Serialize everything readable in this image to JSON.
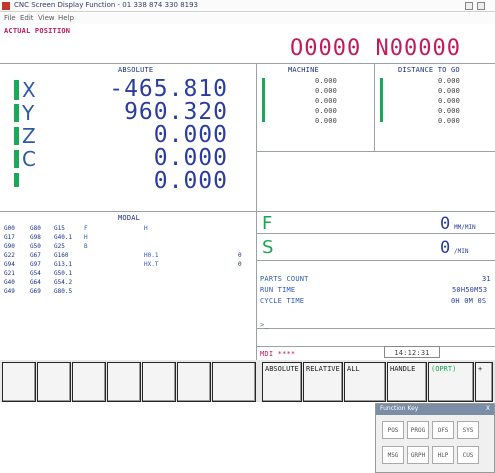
{
  "window": {
    "title": "CNC Screen Display Function - 01 338 874 330 8193",
    "menu": [
      "File",
      "Edit",
      "View",
      "Help"
    ]
  },
  "header": {
    "left": "ACTUAL POSITION",
    "program": "O0000 N00000"
  },
  "absolute": {
    "title": "ABSOLUTE",
    "axes": [
      {
        "name": "X",
        "value": "-465.810"
      },
      {
        "name": "Y",
        "value": "960.320"
      },
      {
        "name": "Z",
        "value": "0.000"
      },
      {
        "name": "C",
        "value": "0.000"
      },
      {
        "name": "",
        "value": "0.000"
      }
    ]
  },
  "machine": {
    "title": "MACHINE",
    "values": [
      "0.000",
      "0.000",
      "0.000",
      "0.000",
      "0.000"
    ]
  },
  "distance": {
    "title": "DISTANCE TO GO",
    "values": [
      "0.000",
      "0.000",
      "0.000",
      "0.000",
      "0.000"
    ]
  },
  "modal": {
    "title": "MODAL",
    "rows": [
      [
        "G00",
        "G80",
        "G15",
        "F",
        "H"
      ],
      [
        "G17",
        "G98",
        "G40.1",
        "H",
        ""
      ],
      [
        "G90",
        "G50",
        "G25",
        "B",
        ""
      ],
      [
        "G22",
        "G67",
        "G160",
        "H0.1",
        "0"
      ],
      [
        "G94",
        "G97",
        "G13.1",
        "HX.T",
        "0"
      ],
      [
        "G21",
        "G54",
        "G50.1",
        "",
        ""
      ],
      [
        "G40",
        "G64",
        "G54.2",
        "",
        ""
      ],
      [
        "G49",
        "G69",
        "G80.5",
        "",
        ""
      ]
    ]
  },
  "feed": {
    "label": "F",
    "value": "0",
    "unit": "MM/MIN"
  },
  "spindle": {
    "label": "S",
    "value": "0",
    "unit": "/MIN"
  },
  "counters": [
    {
      "label": "PARTS COUNT",
      "value": "31"
    },
    {
      "label": "RUN TIME",
      "value": "50H50M53"
    },
    {
      "label": "CYCLE TIME",
      "value": "0H 0M 0S"
    }
  ],
  "input_prompt": ">_",
  "status": {
    "mode": "MDI ****",
    "time": "14:12:31"
  },
  "softkeys": [
    "",
    "",
    "",
    "",
    "",
    "",
    "",
    "ABSOLUTE",
    "RELATIVE",
    "ALL",
    "HANDLE",
    "(OPRT)",
    "+"
  ],
  "function_key": {
    "title": "Function Key",
    "close": "X",
    "row1": [
      "POS",
      "PROG",
      "OFS",
      "SYS"
    ],
    "row2": [
      "MSG",
      "GRPH",
      "HLP",
      "CUS"
    ]
  },
  "colors": {
    "digit": "#2b3d9f",
    "label_green": "#18a850",
    "program_magenta": "#c21a5c",
    "window_title": "#1e4aa8"
  }
}
